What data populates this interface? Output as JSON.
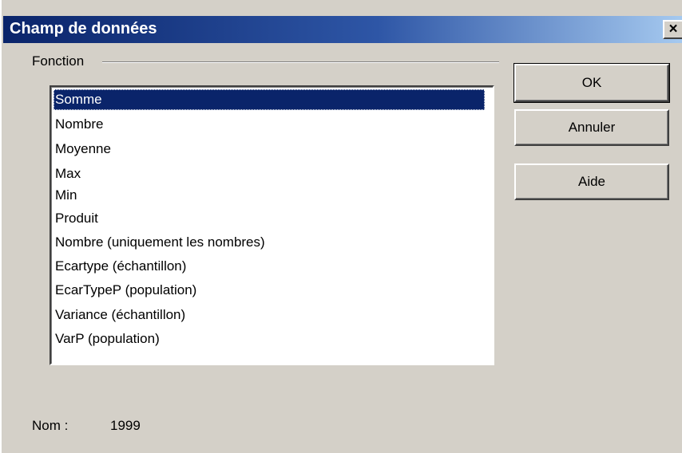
{
  "dialog": {
    "title": "Champ de données",
    "close_glyph": "×"
  },
  "function_group": {
    "label": "Fonction",
    "selected_index": 0,
    "items": [
      "Somme",
      "Nombre",
      "Moyenne",
      "Max",
      "Min",
      "Produit",
      "Nombre (uniquement les nombres)",
      "Ecartype (échantillon)",
      "EcarTypeP (population)",
      "Variance (échantillon)",
      "VarP (population)"
    ]
  },
  "buttons": {
    "ok": "OK",
    "cancel": "Annuler",
    "help": "Aide"
  },
  "name": {
    "label": "Nom :",
    "value": "1999"
  },
  "colors": {
    "titlebar_start": "#0a246a",
    "titlebar_end": "#a6caf0",
    "selection": "#0a246a",
    "face": "#d4d0c8"
  }
}
